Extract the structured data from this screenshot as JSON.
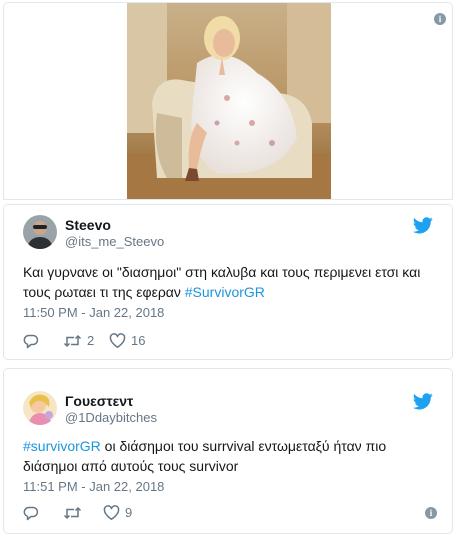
{
  "tweets": [
    {
      "author_name": "Steevo",
      "handle": "@its_me_Steevo",
      "text_plain": "Και γυρνανε οι \"διασημοι\" στη καλυβα και τους περιμενει ετσι και τους ρωταει τι της εφεραν ",
      "hashtag": "#SurvivorGR",
      "text_after": "",
      "timestamp": "11:50 PM - Jan 22, 2018",
      "retweets": "2",
      "likes": "16"
    },
    {
      "author_name": "Γουεστεντ",
      "handle": "@1Ddaybitches",
      "text_plain": "",
      "hashtag": "#survivorGR",
      "text_after": " οι διάσημοι του surrvival εντωμεταξύ ήταν πιο διάσημοι από αυτούς τους survivor",
      "timestamp": "11:51 PM - Jan 22, 2018",
      "retweets": "",
      "likes": "9"
    }
  ],
  "colors": {
    "link": "#1b95e0",
    "twitter_blue": "#1da1f2",
    "muted": "#657786",
    "border": "#e1e8ed"
  },
  "icons": [
    "info-icon",
    "twitter-bird-icon",
    "reply-icon",
    "retweet-icon",
    "like-icon"
  ]
}
